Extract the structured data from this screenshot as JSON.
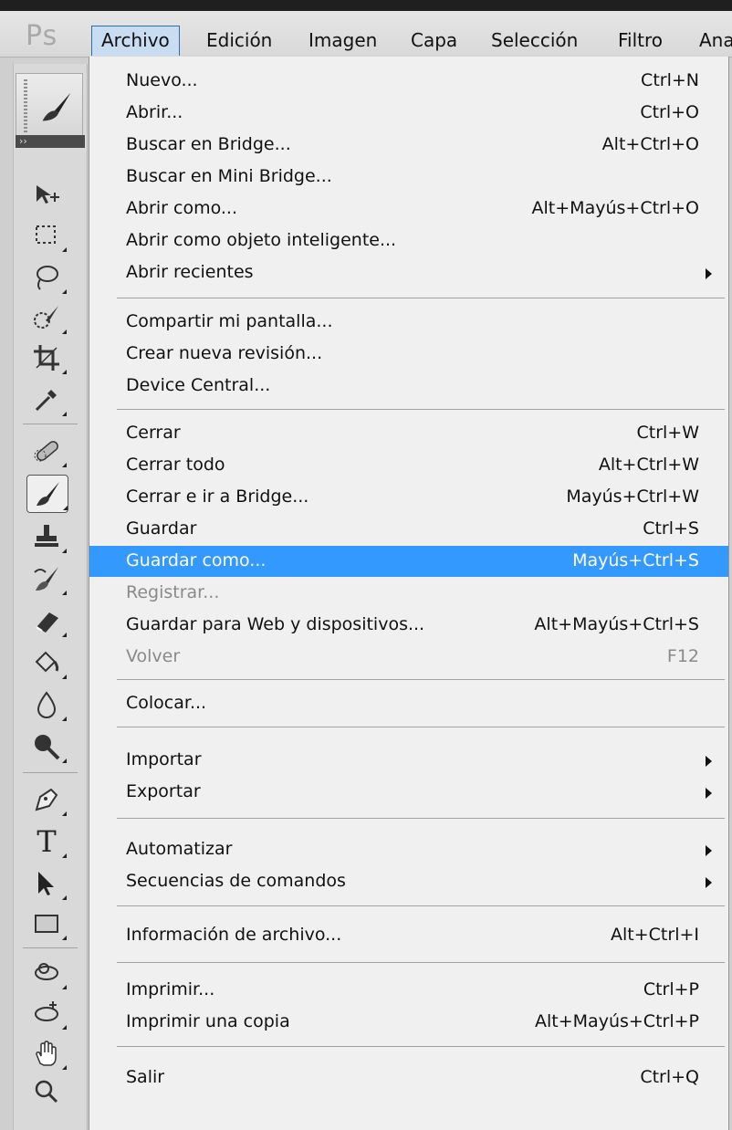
{
  "app": {
    "logo": "Ps"
  },
  "menubar": {
    "items": [
      "Archivo",
      "Edición",
      "Imagen",
      "Capa",
      "Selección",
      "Filtro",
      "Ana"
    ],
    "active": "Archivo"
  },
  "toolbar": {
    "tools": [
      "move-tool",
      "marquee-tool",
      "lasso-tool",
      "quick-selection-tool",
      "crop-tool",
      "eyedropper-tool",
      "spot-healing-tool",
      "brush-tool",
      "clone-stamp-tool",
      "history-brush-tool",
      "eraser-tool",
      "paint-bucket-tool",
      "blur-tool",
      "dodge-tool",
      "pen-tool",
      "type-tool",
      "path-selection-tool",
      "rectangle-tool",
      "3d-rotate-tool",
      "3d-orbit-tool",
      "hand-tool",
      "zoom-tool"
    ],
    "selected": "brush-tool"
  },
  "menu": {
    "items": [
      {
        "label": "Nuevo...",
        "shortcut": "Ctrl+N"
      },
      {
        "label": "Abrir...",
        "shortcut": "Ctrl+O"
      },
      {
        "label": "Buscar en Bridge...",
        "shortcut": "Alt+Ctrl+O"
      },
      {
        "label": "Buscar en Mini Bridge...",
        "shortcut": ""
      },
      {
        "label": "Abrir como...",
        "shortcut": "Alt+Mayús+Ctrl+O"
      },
      {
        "label": "Abrir como objeto inteligente...",
        "shortcut": ""
      },
      {
        "label": "Abrir recientes",
        "shortcut": "",
        "submenu": true
      },
      {
        "label": "Compartir mi pantalla...",
        "shortcut": ""
      },
      {
        "label": "Crear nueva revisión...",
        "shortcut": ""
      },
      {
        "label": "Device Central...",
        "shortcut": ""
      },
      {
        "label": "Cerrar",
        "shortcut": "Ctrl+W"
      },
      {
        "label": "Cerrar todo",
        "shortcut": "Alt+Ctrl+W"
      },
      {
        "label": "Cerrar e ir a Bridge...",
        "shortcut": "Mayús+Ctrl+W"
      },
      {
        "label": "Guardar",
        "shortcut": "Ctrl+S"
      },
      {
        "label": "Guardar como...",
        "shortcut": "Mayús+Ctrl+S",
        "highlighted": true
      },
      {
        "label": "Registrar...",
        "shortcut": "",
        "disabled": true
      },
      {
        "label": "Guardar para Web y dispositivos...",
        "shortcut": "Alt+Mayús+Ctrl+S"
      },
      {
        "label": "Volver",
        "shortcut": "F12",
        "disabled": true
      },
      {
        "label": "Colocar...",
        "shortcut": ""
      },
      {
        "label": "Importar",
        "shortcut": "",
        "submenu": true
      },
      {
        "label": "Exportar",
        "shortcut": "",
        "submenu": true
      },
      {
        "label": "Automatizar",
        "shortcut": "",
        "submenu": true
      },
      {
        "label": "Secuencias de comandos",
        "shortcut": "",
        "submenu": true
      },
      {
        "label": "Información de archivo...",
        "shortcut": "Alt+Ctrl+I"
      },
      {
        "label": "Imprimir...",
        "shortcut": "Ctrl+P"
      },
      {
        "label": "Imprimir una copia",
        "shortcut": "Alt+Mayús+Ctrl+P"
      },
      {
        "label": "Salir",
        "shortcut": "Ctrl+Q"
      }
    ]
  },
  "colors": {
    "highlight": "#3399ff",
    "menu_bg": "#f0f0f0",
    "disabled_text": "#8a8a8a"
  }
}
